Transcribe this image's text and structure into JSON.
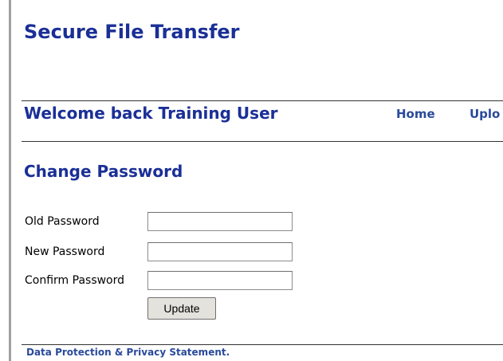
{
  "header": {
    "app_title": "Secure File Transfer"
  },
  "welcome_bar": {
    "welcome_text": "Welcome back Training User",
    "nav": {
      "home": "Home",
      "upload": "Uplo"
    }
  },
  "main": {
    "section_title": "Change Password",
    "form": {
      "old_password_label": "Old Password",
      "old_password_value": "",
      "new_password_label": "New Password",
      "new_password_value": "",
      "confirm_password_label": "Confirm Password",
      "confirm_password_value": "",
      "update_button": "Update"
    }
  },
  "footer": {
    "privacy_link": "Data Protection & Privacy Statement."
  },
  "colors": {
    "heading": "#1a2f96",
    "link": "#2a4a9a",
    "rule": "#333333",
    "left_bar": "#a0a0a0",
    "button_bg": "#e4e2dc"
  }
}
